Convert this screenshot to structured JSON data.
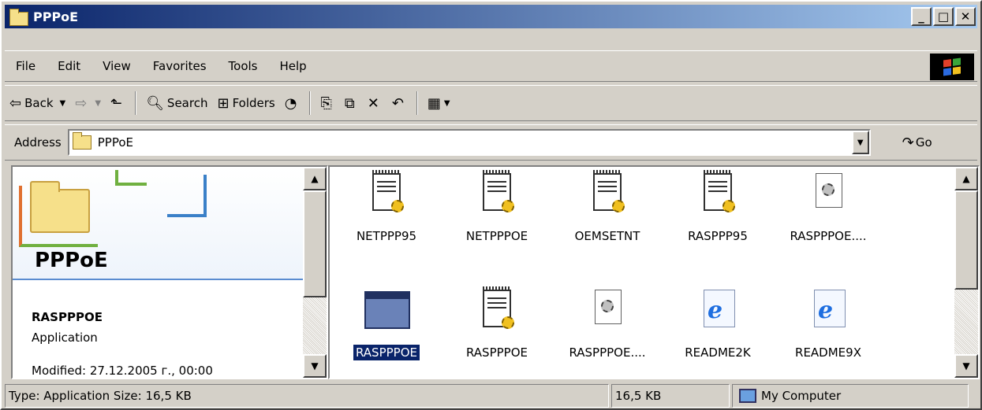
{
  "window": {
    "title": "PPPoE"
  },
  "menu": [
    "File",
    "Edit",
    "View",
    "Favorites",
    "Tools",
    "Help"
  ],
  "toolbar": {
    "back": "Back",
    "search": "Search",
    "folders": "Folders"
  },
  "address": {
    "label": "Address",
    "value": "PPPoE",
    "go": "Go"
  },
  "details": {
    "folder_title": "PPPoE",
    "selected_name": "RASPPPOE",
    "selected_type": "Application",
    "modified": "Modified: 27.12.2005 г., 00:00"
  },
  "files": [
    {
      "name": "NETPPP95",
      "kind": "ini-icon"
    },
    {
      "name": "NETPPPOE",
      "kind": "ini-icon"
    },
    {
      "name": "OEMSETNT",
      "kind": "ini-icon"
    },
    {
      "name": "RASPPP95",
      "kind": "ini-icon"
    },
    {
      "name": "RASPPPOE....",
      "kind": "config-icon"
    },
    {
      "name": "RASPPPOE",
      "kind": "application-icon",
      "selected": true
    },
    {
      "name": "RASPPPOE",
      "kind": "ini-icon"
    },
    {
      "name": "RASPPPOE....",
      "kind": "config-icon"
    },
    {
      "name": "README2K",
      "kind": "ie-document-icon"
    },
    {
      "name": "README9X",
      "kind": "ie-document-icon"
    }
  ],
  "status": {
    "info": "Type: Application Size: 16,5 KB",
    "size": "16,5 KB",
    "zone": "My Computer"
  }
}
